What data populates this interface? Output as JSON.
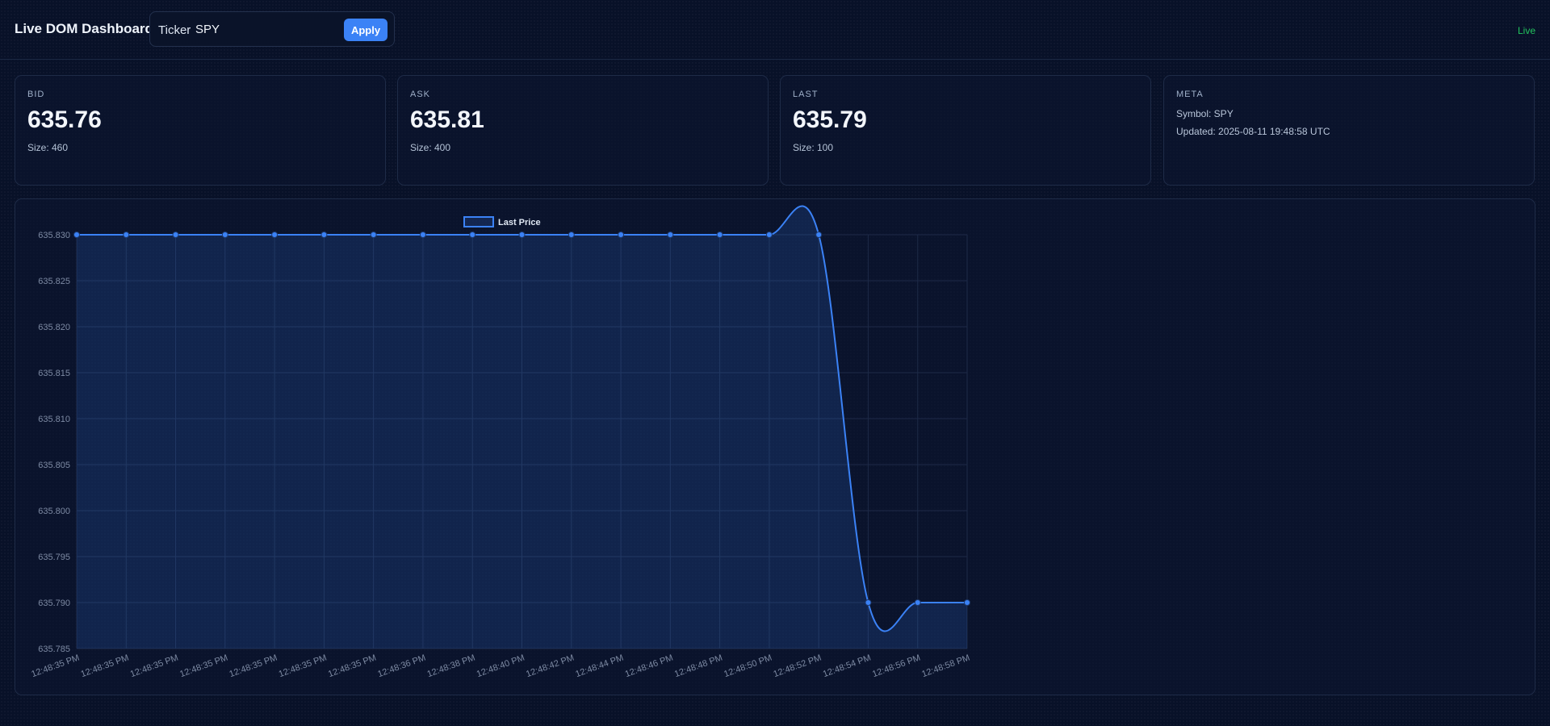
{
  "header": {
    "title": "Live DOM Dashboard",
    "ticker_label": "Ticker",
    "ticker_value": "SPY",
    "apply_label": "Apply",
    "status": "Live"
  },
  "cards": {
    "bid": {
      "label": "BID",
      "value": "635.76",
      "size": "Size: 460"
    },
    "ask": {
      "label": "ASK",
      "value": "635.81",
      "size": "Size: 400"
    },
    "last": {
      "label": "LAST",
      "value": "635.79",
      "size": "Size: 100"
    },
    "meta": {
      "label": "META",
      "symbol": "Symbol: SPY",
      "updated": "Updated: 2025-08-11 19:48:58 UTC"
    }
  },
  "colors": {
    "accent": "#3b82f6",
    "live": "#22c55e",
    "line": "#3b82f6"
  },
  "chart_data": {
    "type": "line",
    "legend": [
      "Last Price"
    ],
    "legend_position": "top-center",
    "grid": true,
    "ylim": [
      635.785,
      635.83
    ],
    "yticks": [
      "635.830",
      "635.825",
      "635.820",
      "635.815",
      "635.810",
      "635.805",
      "635.800",
      "635.795",
      "635.790",
      "635.785"
    ],
    "x": [
      "12:48:35 PM",
      "12:48:35 PM",
      "12:48:35 PM",
      "12:48:35 PM",
      "12:48:35 PM",
      "12:48:35 PM",
      "12:48:35 PM",
      "12:48:36 PM",
      "12:48:38 PM",
      "12:48:40 PM",
      "12:48:42 PM",
      "12:48:44 PM",
      "12:48:46 PM",
      "12:48:48 PM",
      "12:48:50 PM",
      "12:48:52 PM",
      "12:48:54 PM",
      "12:48:56 PM",
      "12:48:58 PM"
    ],
    "series": [
      {
        "name": "Last Price",
        "values": [
          635.83,
          635.83,
          635.83,
          635.83,
          635.83,
          635.83,
          635.83,
          635.83,
          635.83,
          635.83,
          635.83,
          635.83,
          635.83,
          635.83,
          635.83,
          635.83,
          635.79,
          635.79,
          635.79
        ]
      }
    ],
    "point_marker_indices": [
      0,
      1,
      2,
      3,
      4,
      5,
      6,
      7,
      8,
      9,
      10,
      11,
      12,
      13,
      14,
      15,
      16,
      17,
      18
    ]
  }
}
